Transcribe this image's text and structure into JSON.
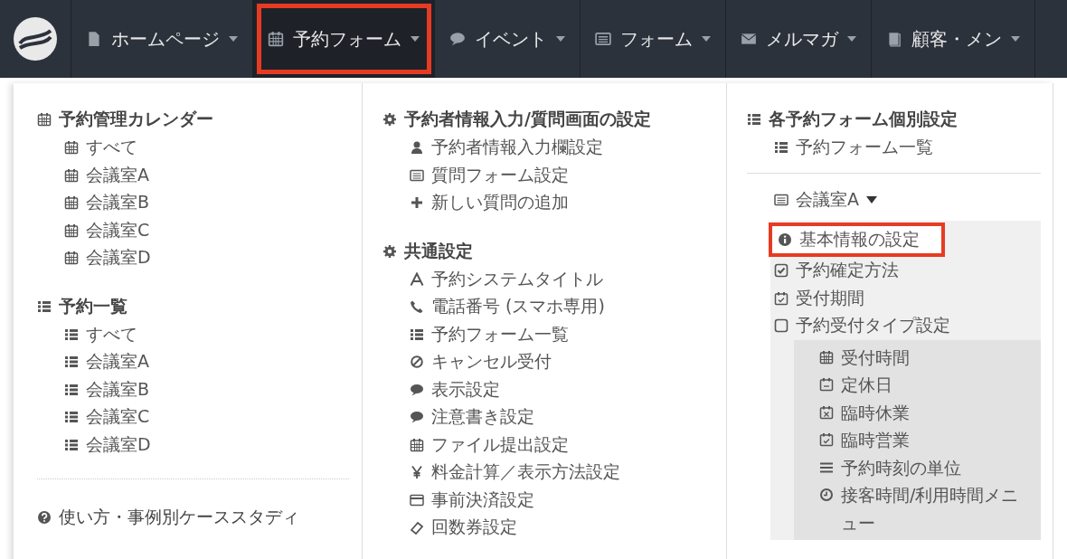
{
  "nav": {
    "items": [
      {
        "label": "ホームページ",
        "kind": "file",
        "selected": false,
        "highlighted": false
      },
      {
        "label": "予約フォーム",
        "kind": "calendar",
        "selected": true,
        "highlighted": true
      },
      {
        "label": "イベント",
        "kind": "comment",
        "selected": false,
        "highlighted": false
      },
      {
        "label": "フォーム",
        "kind": "form",
        "selected": false,
        "highlighted": false
      },
      {
        "label": "メルマガ",
        "kind": "envelope",
        "selected": false,
        "highlighted": false
      },
      {
        "label": "顧客・メン",
        "kind": "book",
        "selected": false,
        "highlighted": false
      }
    ]
  },
  "menu": {
    "columns": [
      {
        "sections": [
          {
            "title": "予約管理カレンダー",
            "kind": "calendar",
            "items": [
              {
                "label": "すべて",
                "kind": "calendar"
              },
              {
                "label": "会議室A",
                "kind": "calendar"
              },
              {
                "label": "会議室B",
                "kind": "calendar"
              },
              {
                "label": "会議室C",
                "kind": "calendar"
              },
              {
                "label": "会議室D",
                "kind": "calendar"
              }
            ]
          },
          {
            "title": "予約一覧",
            "kind": "list",
            "items": [
              {
                "label": "すべて",
                "kind": "list"
              },
              {
                "label": "会議室A",
                "kind": "list"
              },
              {
                "label": "会議室B",
                "kind": "list"
              },
              {
                "label": "会議室C",
                "kind": "list"
              },
              {
                "label": "会議室D",
                "kind": "list"
              }
            ]
          }
        ],
        "link": {
          "label": "使い方・事例別ケーススタディ",
          "kind": "question"
        }
      },
      {
        "sections": [
          {
            "title": "予約者情報入力/質問画面の設定",
            "kind": "gear",
            "items": [
              {
                "label": "予約者情報入力欄設定",
                "kind": "user"
              },
              {
                "label": "質問フォーム設定",
                "kind": "form"
              },
              {
                "label": "新しい質問の追加",
                "kind": "plus"
              }
            ]
          },
          {
            "title": "共通設定",
            "kind": "gear",
            "items": [
              {
                "label": "予約システムタイトル",
                "kind": "font"
              },
              {
                "label": "電話番号 (スマホ専用)",
                "kind": "phone"
              },
              {
                "label": "予約フォーム一覧",
                "kind": "list"
              },
              {
                "label": "キャンセル受付",
                "kind": "ban"
              },
              {
                "label": "表示設定",
                "kind": "comment"
              },
              {
                "label": "注意書き設定",
                "kind": "comment"
              },
              {
                "label": "ファイル提出設定",
                "kind": "calendar"
              },
              {
                "label": "料金計算／表示方法設定",
                "kind": "yen"
              },
              {
                "label": "事前決済設定",
                "kind": "card"
              },
              {
                "label": "回数券設定",
                "kind": "ticket"
              }
            ]
          }
        ]
      },
      {
        "sections": [
          {
            "title": "各予約フォーム個別設定",
            "kind": "list",
            "items": [
              {
                "label": "予約フォーム一覧",
                "kind": "list"
              }
            ]
          }
        ],
        "group": {
          "label": "会議室A",
          "kind": "form",
          "expanded": true,
          "items": [
            {
              "label": "基本情報の設定",
              "kind": "info",
              "highlighted": true
            },
            {
              "label": "予約確定方法",
              "kind": "check-square",
              "highlighted": false
            },
            {
              "label": "受付期間",
              "kind": "calendar-check",
              "highlighted": false
            },
            {
              "label": "予約受付タイプ設定",
              "kind": "square",
              "highlighted": false,
              "children": [
                {
                  "label": "受付時間",
                  "kind": "calendar"
                },
                {
                  "label": "定休日",
                  "kind": "calendar-minus"
                },
                {
                  "label": "臨時休業",
                  "kind": "calendar-x"
                },
                {
                  "label": "臨時営業",
                  "kind": "calendar-check"
                },
                {
                  "label": "予約時刻の単位",
                  "kind": "bars"
                },
                {
                  "label": "接客時間/利用時間メニュー",
                  "kind": "clock"
                }
              ]
            }
          ]
        }
      }
    ]
  }
}
